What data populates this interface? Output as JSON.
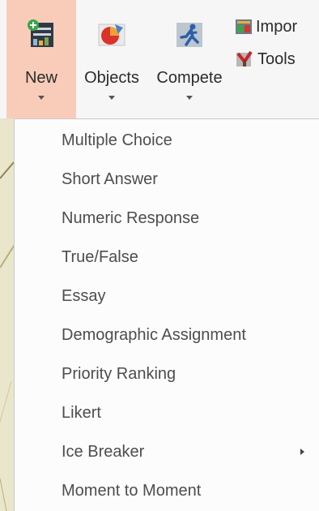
{
  "ribbon": {
    "buttons": [
      {
        "label": "New",
        "icon": "new-question-icon",
        "active": true
      },
      {
        "label": "Objects",
        "icon": "objects-pie-icon",
        "active": false
      },
      {
        "label": "Compete",
        "icon": "compete-runner-icon",
        "active": false
      }
    ],
    "small_buttons": [
      {
        "label": "Impor",
        "icon": "import-icon"
      },
      {
        "label": "Tools",
        "icon": "tools-icon"
      }
    ]
  },
  "menu": {
    "items": [
      {
        "label": "Multiple Choice"
      },
      {
        "label": "Short Answer"
      },
      {
        "label": "Numeric Response"
      },
      {
        "label": "True/False"
      },
      {
        "label": "Essay"
      },
      {
        "label": "Demographic Assignment"
      },
      {
        "label": "Priority Ranking"
      },
      {
        "label": "Likert"
      },
      {
        "label": "Ice Breaker",
        "has_submenu": true
      },
      {
        "label": "Moment to Moment"
      }
    ]
  },
  "colors": {
    "active_button": "#f9ccba",
    "ribbon_bg": "#f6f6f6",
    "menu_bg": "#fcfcfc",
    "menu_text": "#4d4d4d"
  }
}
